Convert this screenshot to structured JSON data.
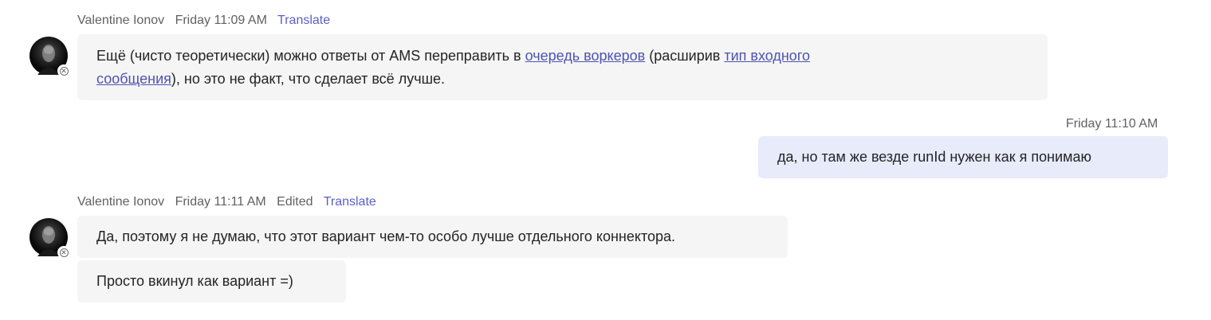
{
  "messages": [
    {
      "author": "Valentine Ionov",
      "time": "Friday 11:09 AM",
      "translate": "Translate",
      "text_parts": {
        "p1": "Ещё (чисто теоретически) можно ответы от AMS переправить в ",
        "link1": "очередь воркеров",
        "p2": " (расширив ",
        "link2a": "тип входного",
        "link2b": "сообщения",
        "p3": "), но это не факт, что сделает всё лучше."
      }
    },
    {
      "time": "Friday 11:10 AM",
      "text": "да, но там же везде runId нужен как я понимаю"
    },
    {
      "author": "Valentine Ionov",
      "time": "Friday 11:11 AM",
      "edited": "Edited",
      "translate": "Translate",
      "text1": "Да, поэтому я не думаю, что этот вариант чем-то особо лучше отдельного коннектора.",
      "text2": "Просто вкинул как вариант =)"
    }
  ],
  "icons": {
    "presence": "presence-offline-icon"
  }
}
